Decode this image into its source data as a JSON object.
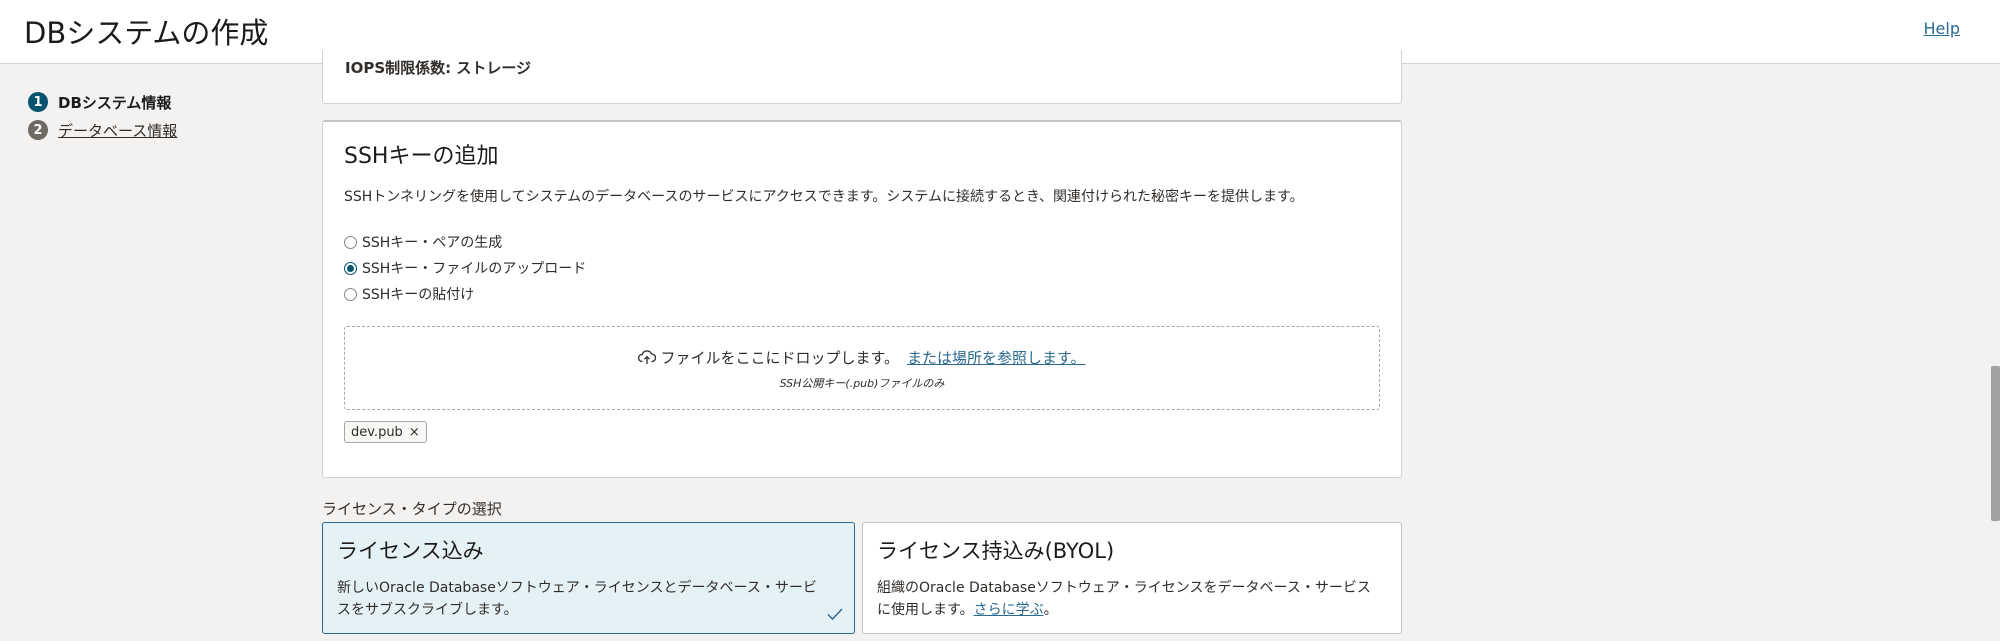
{
  "header": {
    "title": "DBシステムの作成",
    "help_label": "Help"
  },
  "steps": [
    {
      "number": "1",
      "label": "DBシステム情報",
      "state": "active"
    },
    {
      "number": "2",
      "label": "データベース情報",
      "state": "inactive"
    }
  ],
  "top_card": {
    "partial_text": "IOPS制限係数: ストレージ"
  },
  "ssh": {
    "title": "SSHキーの追加",
    "description": "SSHトンネリングを使用してシステムのデータベースのサービスにアクセスできます。システムに接続するとき、関連付けられた秘密キーを提供します。",
    "options": [
      {
        "label": "SSHキー・ペアの生成",
        "checked": false
      },
      {
        "label": "SSHキー・ファイルのアップロード",
        "checked": true
      },
      {
        "label": "SSHキーの貼付け",
        "checked": false
      }
    ],
    "dropzone": {
      "text": "ファイルをここにドロップします。",
      "link": "または場所を参照します。",
      "hint": "SSH公開キー(.pub)ファイルのみ"
    },
    "file_chip": {
      "name": "dev.pub",
      "remove": "×"
    }
  },
  "license": {
    "label": "ライセンス・タイプの選択",
    "cards": [
      {
        "title": "ライセンス込み",
        "description": "新しいOracle Databaseソフトウェア・ライセンスとデータベース・サービスをサブスクライブします。",
        "selected": true
      },
      {
        "title": "ライセンス持込み(BYOL)",
        "description": "組織のOracle Databaseソフトウェア・ライセンスをデータベース・サービスに使用します。",
        "link": "さらに学ぶ",
        "after_link": "。",
        "selected": false
      }
    ]
  },
  "colors": {
    "accent": "#04536f",
    "link": "#2b6b8f",
    "selected_bg": "#e4f1f7",
    "page_bg": "#f3f2f1"
  }
}
